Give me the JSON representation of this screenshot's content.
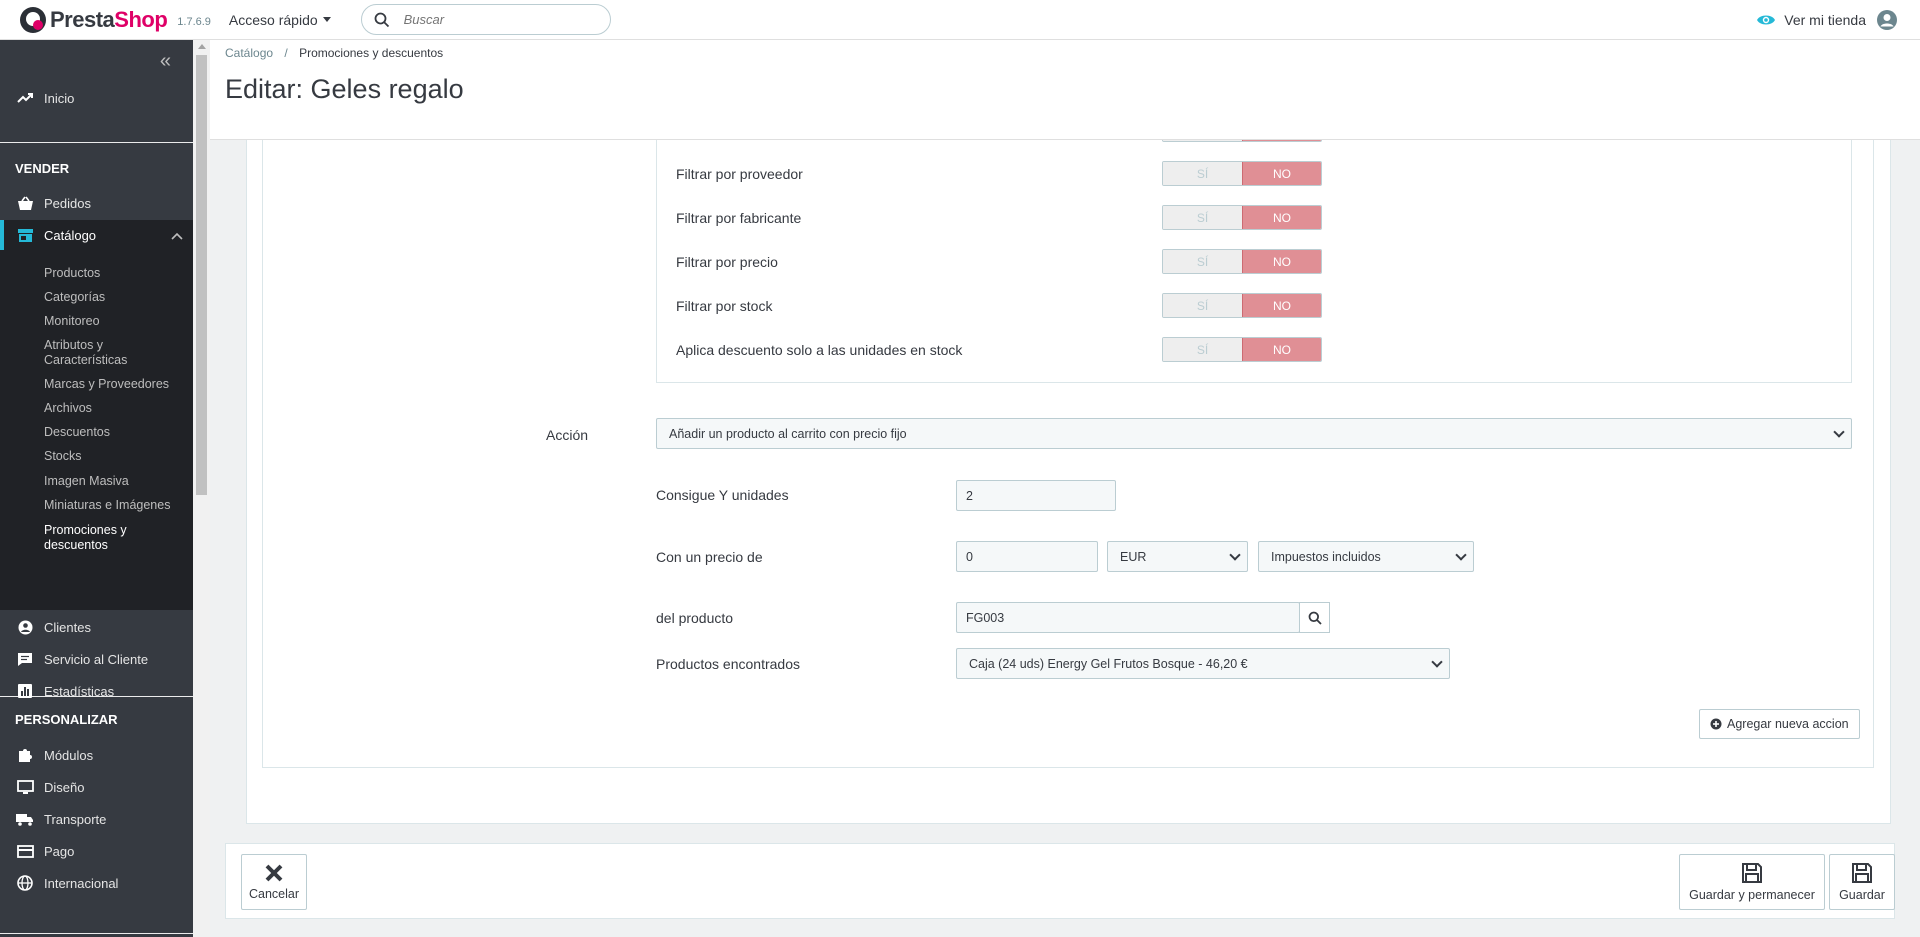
{
  "header": {
    "brand_presta": "Presta",
    "brand_shop": "Shop",
    "version": "1.7.6.9",
    "quick_access": "Acceso rápido",
    "search_placeholder": "Buscar",
    "view_store": "Ver mi tienda"
  },
  "sidebar": {
    "home": "Inicio",
    "section_sell": "VENDER",
    "orders": "Pedidos",
    "catalog": "Catálogo",
    "catalog_sub": [
      "Productos",
      "Categorías",
      "Monitoreo",
      "Atributos y Características",
      "Marcas y Proveedores",
      "Archivos",
      "Descuentos",
      "Stocks",
      "Imagen Masiva",
      "Miniaturas e Imágenes",
      "Promociones y descuentos"
    ],
    "customers": "Clientes",
    "customer_service": "Servicio al Cliente",
    "stats": "Estadísticas",
    "section_customize": "PERSONALIZAR",
    "modules": "Módulos",
    "design": "Diseño",
    "shipping": "Transporte",
    "payment": "Pago",
    "international": "Internacional"
  },
  "page": {
    "breadcrumb_parent": "Catálogo",
    "breadcrumb_sep": "/",
    "breadcrumb_current": "Promociones y descuentos",
    "title": "Editar: Geles regalo"
  },
  "filters": {
    "yes": "SÍ",
    "no": "NO",
    "rows": [
      "Filtrar por proveedor",
      "Filtrar por fabricante",
      "Filtrar por precio",
      "Filtrar por stock",
      "Aplica descuento solo a las unidades en stock"
    ]
  },
  "action": {
    "label": "Acción",
    "selected": "Añadir un producto al carrito con precio fijo",
    "units_label": "Consigue Y unidades",
    "units_value": "2",
    "price_label": "Con un precio de",
    "price_value": "0",
    "currency": "EUR",
    "tax": "Impuestos incluidos",
    "product_label": "del producto",
    "product_value": "FG003",
    "found_label": "Productos encontrados",
    "found_value": "Caja (24 uds) Energy Gel Frutos Bosque - 46,20 €",
    "add_action": "Agregar nueva accion"
  },
  "footer": {
    "cancel": "Cancelar",
    "save_stay": "Guardar y permanecer",
    "save": "Guardar"
  }
}
